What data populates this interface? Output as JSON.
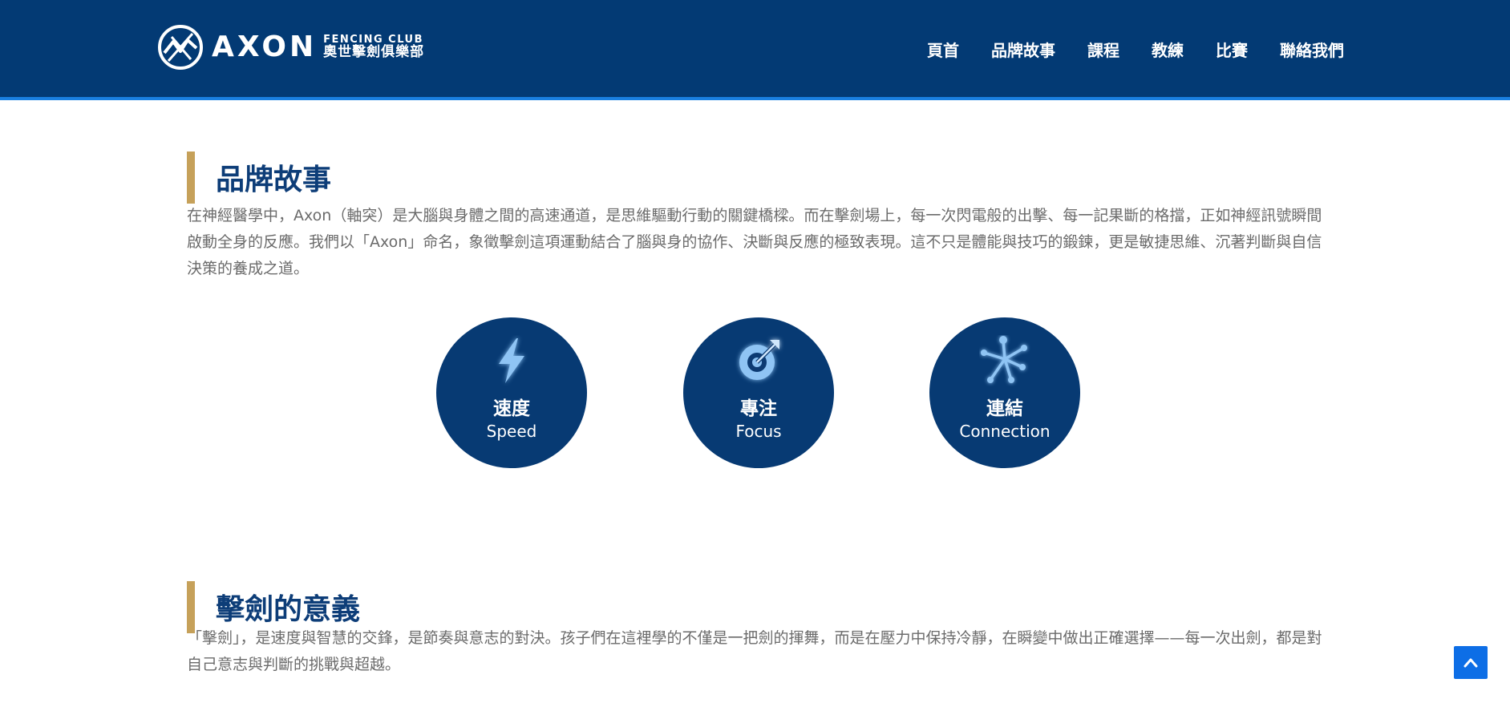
{
  "brand": {
    "logo_text": "AXON",
    "sub_en": "FENCING CLUB",
    "sub_zh": "奧世擊劍俱樂部"
  },
  "nav": {
    "items": [
      {
        "label": "頁首"
      },
      {
        "label": "品牌故事"
      },
      {
        "label": "課程"
      },
      {
        "label": "教練"
      },
      {
        "label": "比賽"
      },
      {
        "label": "聯絡我們"
      }
    ]
  },
  "story": {
    "title": "品牌故事",
    "body": "在神經醫學中，Axon（軸突）是大腦與身體之間的高速通道，是思維驅動行動的關鍵橋樑。而在擊劍場上，每一次閃電般的出擊、每一記果斷的格擋，正如神經訊號瞬間啟動全身的反應。我們以「Axon」命名，象徵擊劍這項運動結合了腦與身的協作、決斷與反應的極致表現。這不只是體能與技巧的鍛鍊，更是敏捷思維、沉著判斷與自信決策的養成之道。"
  },
  "values": [
    {
      "zh": "速度",
      "en": "Speed",
      "icon": "lightning-icon"
    },
    {
      "zh": "專注",
      "en": "Focus",
      "icon": "target-icon"
    },
    {
      "zh": "連結",
      "en": "Connection",
      "icon": "network-icon"
    }
  ],
  "meaning": {
    "title": "擊劍的意義",
    "body": "「擊劍」，是速度與智慧的交鋒，是節奏與意志的對決。孩子們在這裡學的不僅是一把劍的揮舞，而是在壓力中保持冷靜，在瞬變中做出正確選擇——每一次出劍，都是對自己意志與判斷的挑戰與超越。"
  },
  "colors": {
    "header_bg": "#033a74",
    "accent_bar": "#c6a15a",
    "title_text": "#0d3d78",
    "circle_bg": "#073a73",
    "icon_glow": "#8fc4f4",
    "to_top_bg": "#0d6ee6"
  },
  "to_top": {
    "icon": "chevron-up-icon"
  }
}
